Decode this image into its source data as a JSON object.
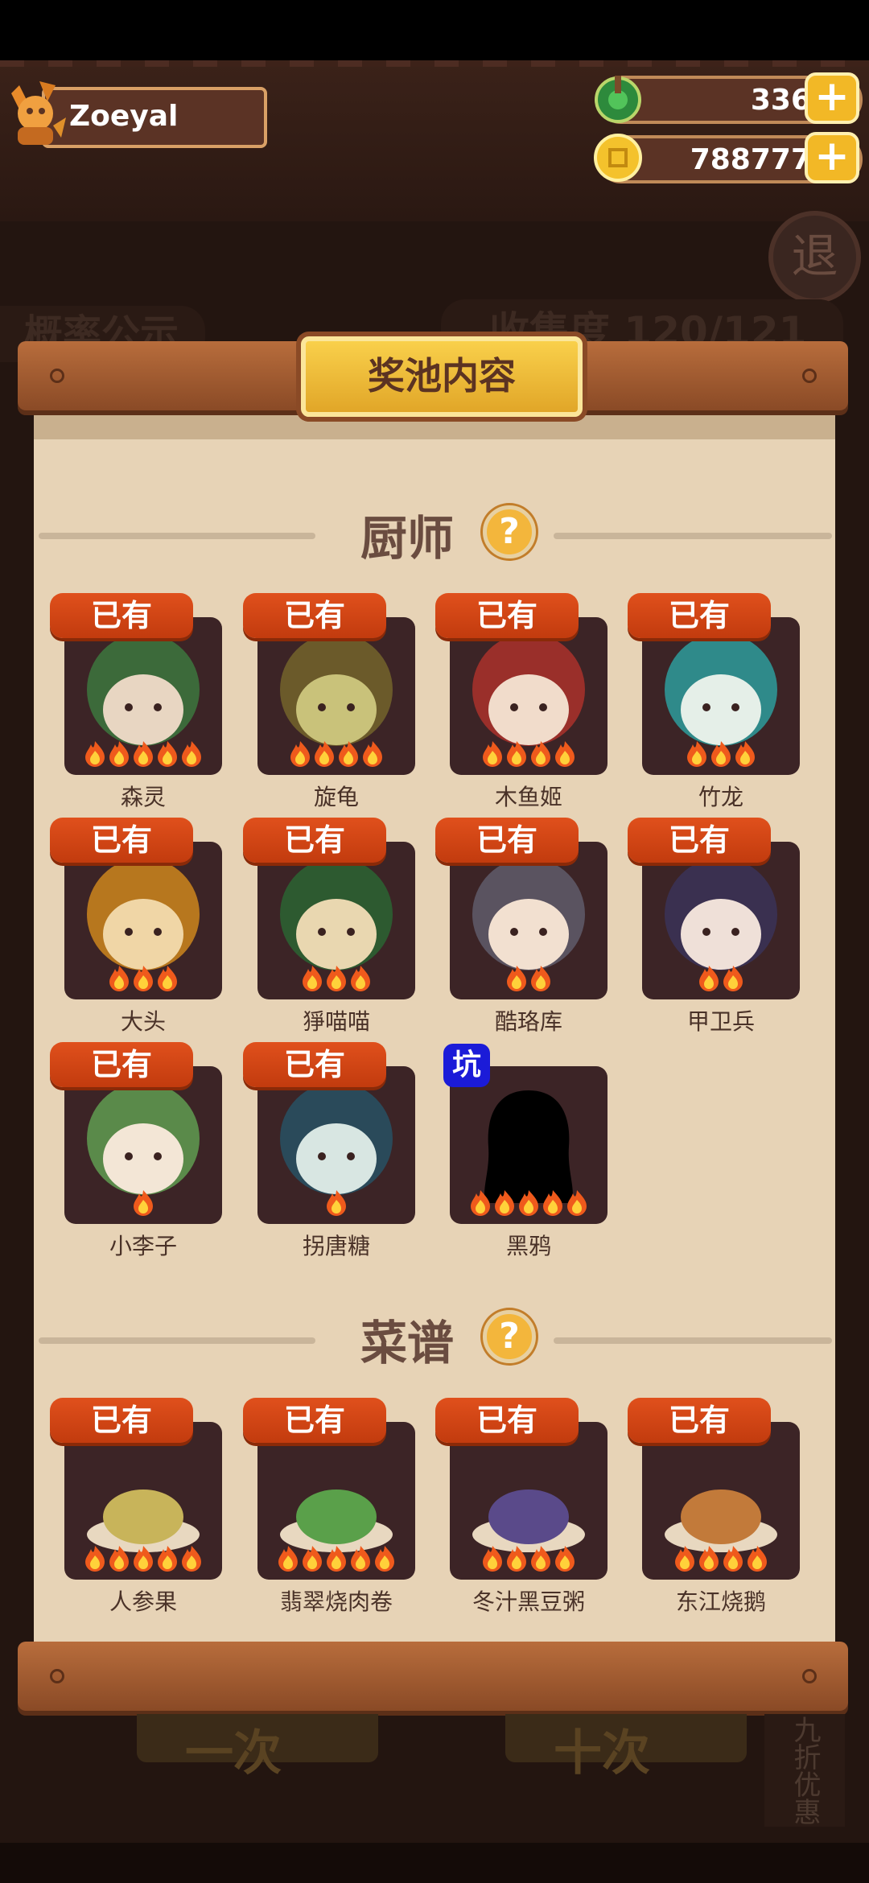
{
  "player": {
    "name": "Zoeyal"
  },
  "currency": {
    "jade": "336",
    "coins": "788777"
  },
  "background": {
    "exit_label": "退",
    "notice_label": "概率公示",
    "collection_label": "收集度 120/121",
    "single_draw_label": "一次",
    "ten_draw_label": "十次",
    "discount_label": "九折优惠"
  },
  "panel": {
    "title": "奖池内容"
  },
  "chefs_section": {
    "title": "厨师",
    "help_label": "?",
    "items": [
      {
        "name": "森灵",
        "badge": "已有",
        "stars": 5
      },
      {
        "name": "旋龟",
        "badge": "已有",
        "stars": 4
      },
      {
        "name": "木鱼姬",
        "badge": "已有",
        "stars": 4
      },
      {
        "name": "竹龙",
        "badge": "已有",
        "stars": 3
      },
      {
        "name": "大头",
        "badge": "已有",
        "stars": 3
      },
      {
        "name": "猙喵喵",
        "badge": "已有",
        "stars": 3
      },
      {
        "name": "酷珞库",
        "badge": "已有",
        "stars": 2
      },
      {
        "name": "甲卫兵",
        "badge": "已有",
        "stars": 2
      },
      {
        "name": "小李子",
        "badge": "已有",
        "stars": 1
      },
      {
        "name": "拐唐糖",
        "badge": "已有",
        "stars": 1
      },
      {
        "name": "黑鸦",
        "badge": "坑",
        "stars": 5
      }
    ]
  },
  "recipes_section": {
    "title": "菜谱",
    "help_label": "?",
    "items": [
      {
        "name": "人参果",
        "badge": "已有",
        "stars": 5
      },
      {
        "name": "翡翠烧肉卷",
        "badge": "已有",
        "stars": 5
      },
      {
        "name": "冬汁黑豆粥",
        "badge": "已有",
        "stars": 4
      },
      {
        "name": "东江烧鹅",
        "badge": "已有",
        "stars": 4
      }
    ]
  },
  "colors": {
    "badge_owned": "#d2450f",
    "badge_pit": "#1b1bd8",
    "panel_wood": "#a45c30",
    "scroll": "#e7d3b6",
    "title_plate": "#f2bf3a"
  }
}
